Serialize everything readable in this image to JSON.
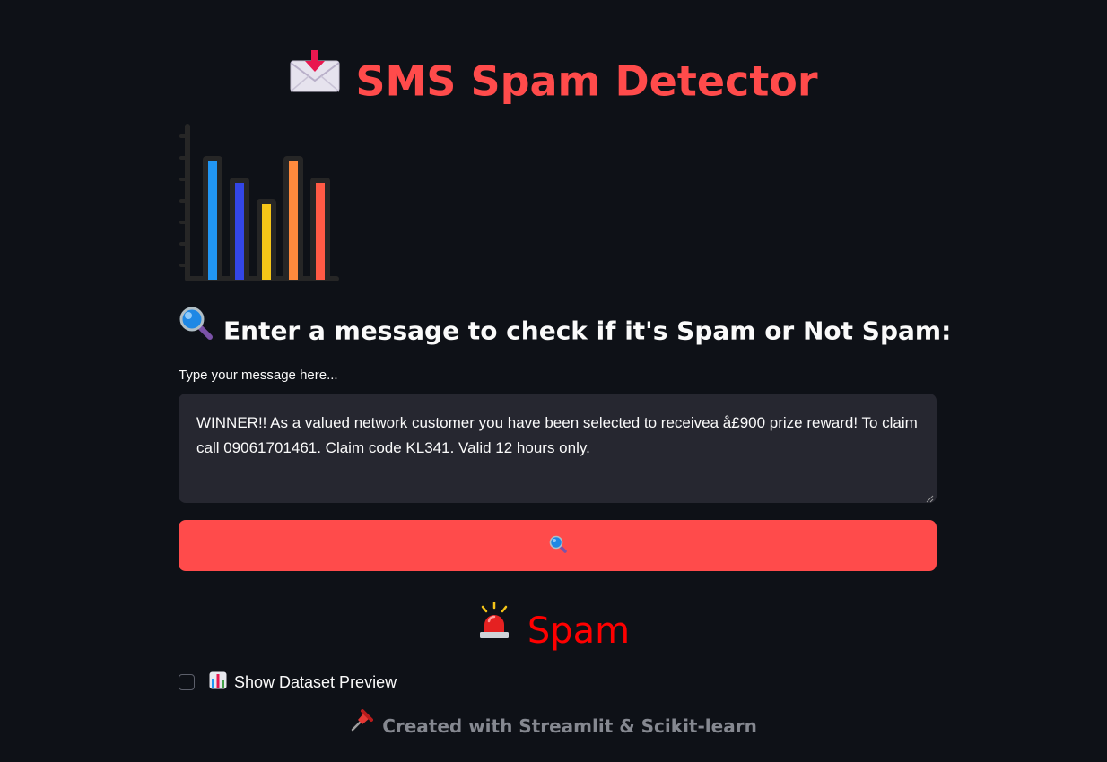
{
  "header": {
    "title": "SMS Spam Detector",
    "title_color": "#ff4b4b",
    "icon": "envelope-with-arrow-icon"
  },
  "hero_image": {
    "icon": "bar-chart-illustration",
    "bar_colors": [
      "#2196f3",
      "#3346e6",
      "#f5c518",
      "#ff8a3d",
      "#ff5a45"
    ]
  },
  "prompt": {
    "icon": "magnifying-glass-icon",
    "subheader": "Enter a message to check if it's Spam or Not Spam:"
  },
  "message_input": {
    "label": "Type your message here...",
    "value": "WINNER!! As a valued network customer you have been selected to receivea å£900 prize reward! To claim call 09061701461. Claim code KL341. Valid 12 hours only."
  },
  "check_button": {
    "icon": "magnifying-glass-icon",
    "background": "#ff4b4b"
  },
  "result": {
    "icon": "police-siren-icon",
    "label": "Spam",
    "color": "#ff0000"
  },
  "dataset_toggle": {
    "icon": "bar-chart-emoji-icon",
    "label": "Show Dataset Preview",
    "checked": false
  },
  "footer": {
    "icon": "pushpin-icon",
    "text": "Created with Streamlit & Scikit-learn"
  },
  "theme": {
    "background": "#0e1117",
    "input_background": "#262730",
    "text": "#fafafa",
    "muted_text": "#858890"
  }
}
